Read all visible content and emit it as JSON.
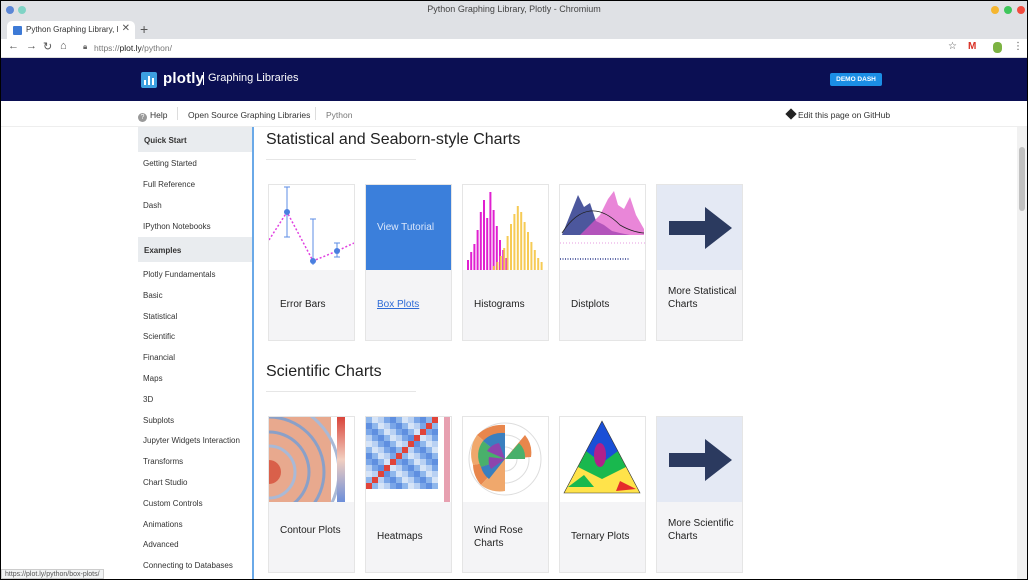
{
  "window": {
    "title": "Python Graphing Library, Plotly - Chromium"
  },
  "tab": {
    "title": "Python Graphing Library, Plotly",
    "close": "✕",
    "new_tab": "+"
  },
  "address": {
    "scheme": "https://",
    "host": "plot.ly",
    "path": "/python/"
  },
  "header": {
    "logo_text": "plotly",
    "logo_subtitle": "Graphing Libraries",
    "demo_button": "DEMO DASH"
  },
  "subnav": {
    "help": "Help",
    "open_source": "Open Source Graphing Libraries",
    "python": "Python",
    "github": "Edit this page on GitHub"
  },
  "sidebar": {
    "quick_start_head": "Quick Start",
    "quick_start": [
      "Getting Started",
      "Full Reference",
      "Dash",
      "IPython Notebooks"
    ],
    "examples_head": "Examples",
    "examples": [
      "Plotly Fundamentals",
      "Basic",
      "Statistical",
      "Scientific",
      "Financial",
      "Maps",
      "3D",
      "Subplots",
      "Jupyter Widgets Interaction",
      "Transforms",
      "Chart Studio",
      "Custom Controls",
      "Animations",
      "Advanced",
      "Connecting to Databases"
    ]
  },
  "sections": {
    "statistical": {
      "title": "Statistical and Seaborn-style Charts",
      "cards": [
        "Error Bars",
        "Box Plots",
        "Histograms",
        "Distplots",
        "More Statistical Charts"
      ],
      "view_tutorial": "View Tutorial"
    },
    "scientific": {
      "title": "Scientific Charts",
      "cards": [
        "Contour Plots",
        "Heatmaps",
        "Wind Rose Charts",
        "Ternary Plots",
        "More Scientific Charts"
      ]
    }
  },
  "status": {
    "url": "https://plot.ly/python/box-plots/"
  },
  "colors": {
    "header_bg": "#0b0f53",
    "accent": "#1b8ee5",
    "link": "#2e6bd6"
  }
}
